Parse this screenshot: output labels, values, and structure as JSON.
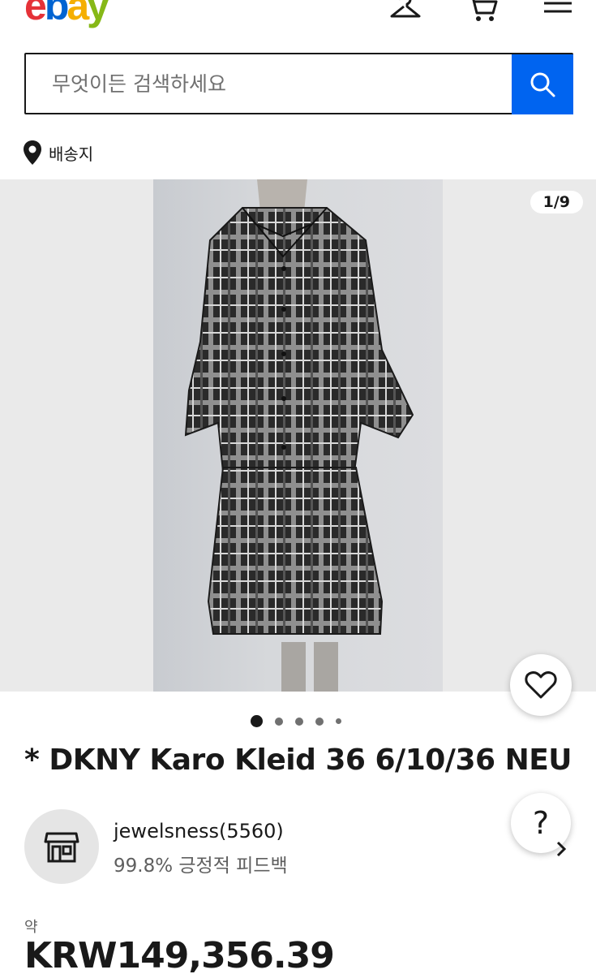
{
  "header": {
    "logo": {
      "e": "e",
      "b": "b",
      "a": "a",
      "y": "y"
    },
    "icons": [
      "hanger-icon",
      "cart-icon",
      "menu-icon"
    ]
  },
  "search": {
    "placeholder": "무엇이든 검색하세요",
    "button_icon": "search-icon"
  },
  "shipto": {
    "label": "배송지",
    "icon": "location-pin-icon"
  },
  "gallery": {
    "counter": "1/9",
    "dots": {
      "total": 5,
      "active": 0
    }
  },
  "listing": {
    "title": "* DKNY Karo Kleid 36 6/10/36 NEU"
  },
  "seller": {
    "name": "jewelsness(5560)",
    "feedback": "99.8% 긍정적 피드백",
    "avatar_icon": "store-icon"
  },
  "help_label": "?",
  "price": {
    "approx_label": "약",
    "value": "KRW149,356.39"
  },
  "colors": {
    "accent": "#0064f0",
    "text": "#191919",
    "muted": "#5f5f5f"
  }
}
